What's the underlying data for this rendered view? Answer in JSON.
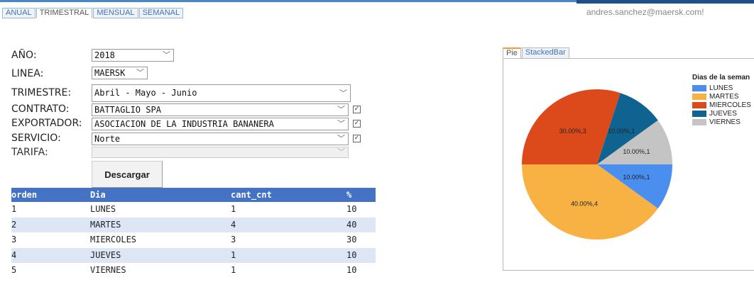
{
  "nav": {
    "tabs": [
      {
        "label": "ANUAL"
      },
      {
        "label": "TRIMESTRAL"
      },
      {
        "label": "MENSUAL"
      },
      {
        "label": "SEMANAL"
      }
    ],
    "active_tab": "TRIMESTRAL",
    "user_email": "andres.sanchez@maersk.com!"
  },
  "form": {
    "anio": {
      "label": "AÑO:",
      "value": "2018"
    },
    "linea": {
      "label": "LINEA:",
      "value": "MAERSK"
    },
    "trimestre": {
      "label": "TRIMESTRE:",
      "value": "Abril - Mayo - Junio"
    },
    "contrato": {
      "label": "CONTRATO:",
      "value": "BATTAGLIO SPA",
      "checked": true
    },
    "exportador": {
      "label": "EXPORTADOR:",
      "value": "ASOCIACION DE LA INDUSTRIA BANANERA",
      "checked": true
    },
    "servicio": {
      "label": "SERVICIO:",
      "value": "Norte",
      "checked": true
    },
    "tarifa": {
      "label": "TARIFA:",
      "value": "",
      "disabled": true
    },
    "descargar_label": "Descargar"
  },
  "table": {
    "headers": [
      "orden",
      "Dia",
      "cant_cnt",
      "%"
    ],
    "rows": [
      [
        "1",
        "LUNES",
        "1",
        "10"
      ],
      [
        "2",
        "MARTES",
        "4",
        "40"
      ],
      [
        "3",
        "MIERCOLES",
        "3",
        "30"
      ],
      [
        "4",
        "JUEVES",
        "1",
        "10"
      ],
      [
        "5",
        "VIERNES",
        "1",
        "10"
      ]
    ]
  },
  "chart_tabs": [
    {
      "label": "Pie"
    },
    {
      "label": "StackedBar"
    }
  ],
  "chart_data": {
    "type": "pie",
    "legend_title": "Dias de la seman",
    "legend_position": "right",
    "categories": [
      "LUNES",
      "MARTES",
      "MIERCOLES",
      "JUEVES",
      "VIERNES"
    ],
    "values": [
      1,
      4,
      3,
      1,
      1
    ],
    "labels": [
      "10.00%,1",
      "40.00%,4",
      "30.00%,3",
      "10.00%,1",
      "10.00%,1"
    ],
    "colors": [
      "#4a8ef0",
      "#f8b243",
      "#dc4a1c",
      "#0f6390",
      "#c4c4c4"
    ]
  },
  "icons": {
    "chevron": "chevron-down-icon",
    "checkbox": "checkbox-icon"
  }
}
